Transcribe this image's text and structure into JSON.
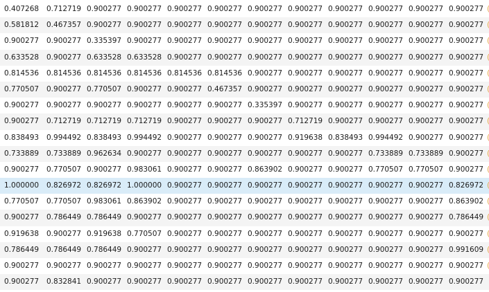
{
  "overflow_marker": "(",
  "selected_row": 11,
  "rows": [
    {
      "cells": [
        "0.407268",
        "0.712719",
        "0.900277",
        "0.900277",
        "0.900277",
        "0.900277",
        "0.900277",
        "0.900277",
        "0.900277",
        "0.900277",
        "0.900277",
        "0.900277"
      ],
      "marker": "("
    },
    {
      "cells": [
        "0.581812",
        "0.467357",
        "0.900277",
        "0.900277",
        "0.900277",
        "0.900277",
        "0.900277",
        "0.900277",
        "0.900277",
        "0.900277",
        "0.900277",
        "0.900277"
      ],
      "marker": "("
    },
    {
      "cells": [
        "0.900277",
        "0.900277",
        "0.335397",
        "0.900277",
        "0.900277",
        "0.900277",
        "0.900277",
        "0.900277",
        "0.900277",
        "0.900277",
        "0.900277",
        "0.900277"
      ],
      "marker": "("
    },
    {
      "cells": [
        "0.633528",
        "0.900277",
        "0.633528",
        "0.633528",
        "0.900277",
        "0.900277",
        "0.900277",
        "0.900277",
        "0.900277",
        "0.900277",
        "0.900277",
        "0.900277"
      ],
      "marker": "("
    },
    {
      "cells": [
        "0.814536",
        "0.814536",
        "0.814536",
        "0.814536",
        "0.814536",
        "0.814536",
        "0.900277",
        "0.900277",
        "0.900277",
        "0.900277",
        "0.900277",
        "0.900277"
      ],
      "marker": "("
    },
    {
      "cells": [
        "0.770507",
        "0.900277",
        "0.770507",
        "0.900277",
        "0.900277",
        "0.467357",
        "0.900277",
        "0.900277",
        "0.900277",
        "0.900277",
        "0.900277",
        "0.900277"
      ],
      "marker": "("
    },
    {
      "cells": [
        "0.900277",
        "0.900277",
        "0.900277",
        "0.900277",
        "0.900277",
        "0.900277",
        "0.335397",
        "0.900277",
        "0.900277",
        "0.900277",
        "0.900277",
        "0.900277"
      ],
      "marker": "("
    },
    {
      "cells": [
        "0.900277",
        "0.712719",
        "0.712719",
        "0.712719",
        "0.900277",
        "0.900277",
        "0.900277",
        "0.712719",
        "0.900277",
        "0.900277",
        "0.900277",
        "0.900277"
      ],
      "marker": "("
    },
    {
      "cells": [
        "0.838493",
        "0.994492",
        "0.838493",
        "0.994492",
        "0.900277",
        "0.900277",
        "0.900277",
        "0.919638",
        "0.838493",
        "0.994492",
        "0.900277",
        "0.900277"
      ],
      "marker": "("
    },
    {
      "cells": [
        "0.733889",
        "0.733889",
        "0.962634",
        "0.900277",
        "0.900277",
        "0.900277",
        "0.900277",
        "0.900277",
        "0.900277",
        "0.733889",
        "0.733889",
        "0.900277"
      ],
      "marker": "("
    },
    {
      "cells": [
        "0.900277",
        "0.770507",
        "0.900277",
        "0.983061",
        "0.900277",
        "0.900277",
        "0.863902",
        "0.900277",
        "0.900277",
        "0.770507",
        "0.770507",
        "0.900277"
      ],
      "marker": "("
    },
    {
      "cells": [
        "1.000000",
        "0.826972",
        "0.826972",
        "1.000000",
        "0.900277",
        "0.900277",
        "0.900277",
        "0.900277",
        "0.900277",
        "0.900277",
        "0.900277",
        "0.826972"
      ],
      "marker": "("
    },
    {
      "cells": [
        "0.770507",
        "0.770507",
        "0.983061",
        "0.863902",
        "0.900277",
        "0.900277",
        "0.900277",
        "0.900277",
        "0.900277",
        "0.900277",
        "0.900277",
        "0.863902"
      ],
      "marker": "("
    },
    {
      "cells": [
        "0.900277",
        "0.786449",
        "0.786449",
        "0.900277",
        "0.900277",
        "0.900277",
        "0.900277",
        "0.900277",
        "0.900277",
        "0.900277",
        "0.900277",
        "0.786449"
      ],
      "marker": "("
    },
    {
      "cells": [
        "0.919638",
        "0.900277",
        "0.919638",
        "0.770507",
        "0.900277",
        "0.900277",
        "0.900277",
        "0.900277",
        "0.900277",
        "0.900277",
        "0.900277",
        "0.900277"
      ],
      "marker": "("
    },
    {
      "cells": [
        "0.786449",
        "0.786449",
        "0.786449",
        "0.900277",
        "0.900277",
        "0.900277",
        "0.900277",
        "0.900277",
        "0.900277",
        "0.900277",
        "0.900277",
        "0.991609"
      ],
      "marker": "("
    },
    {
      "cells": [
        "0.900277",
        "0.900277",
        "0.900277",
        "0.900277",
        "0.900277",
        "0.900277",
        "0.900277",
        "0.900277",
        "0.900277",
        "0.900277",
        "0.900277",
        "0.900277"
      ],
      "marker": "("
    },
    {
      "cells": [
        "0.900277",
        "0.832841",
        "0.900277",
        "0.900277",
        "0.900277",
        "0.900277",
        "0.900277",
        "0.900277",
        "0.900277",
        "0.900277",
        "0.900277",
        "0.900277"
      ],
      "marker": ""
    }
  ]
}
